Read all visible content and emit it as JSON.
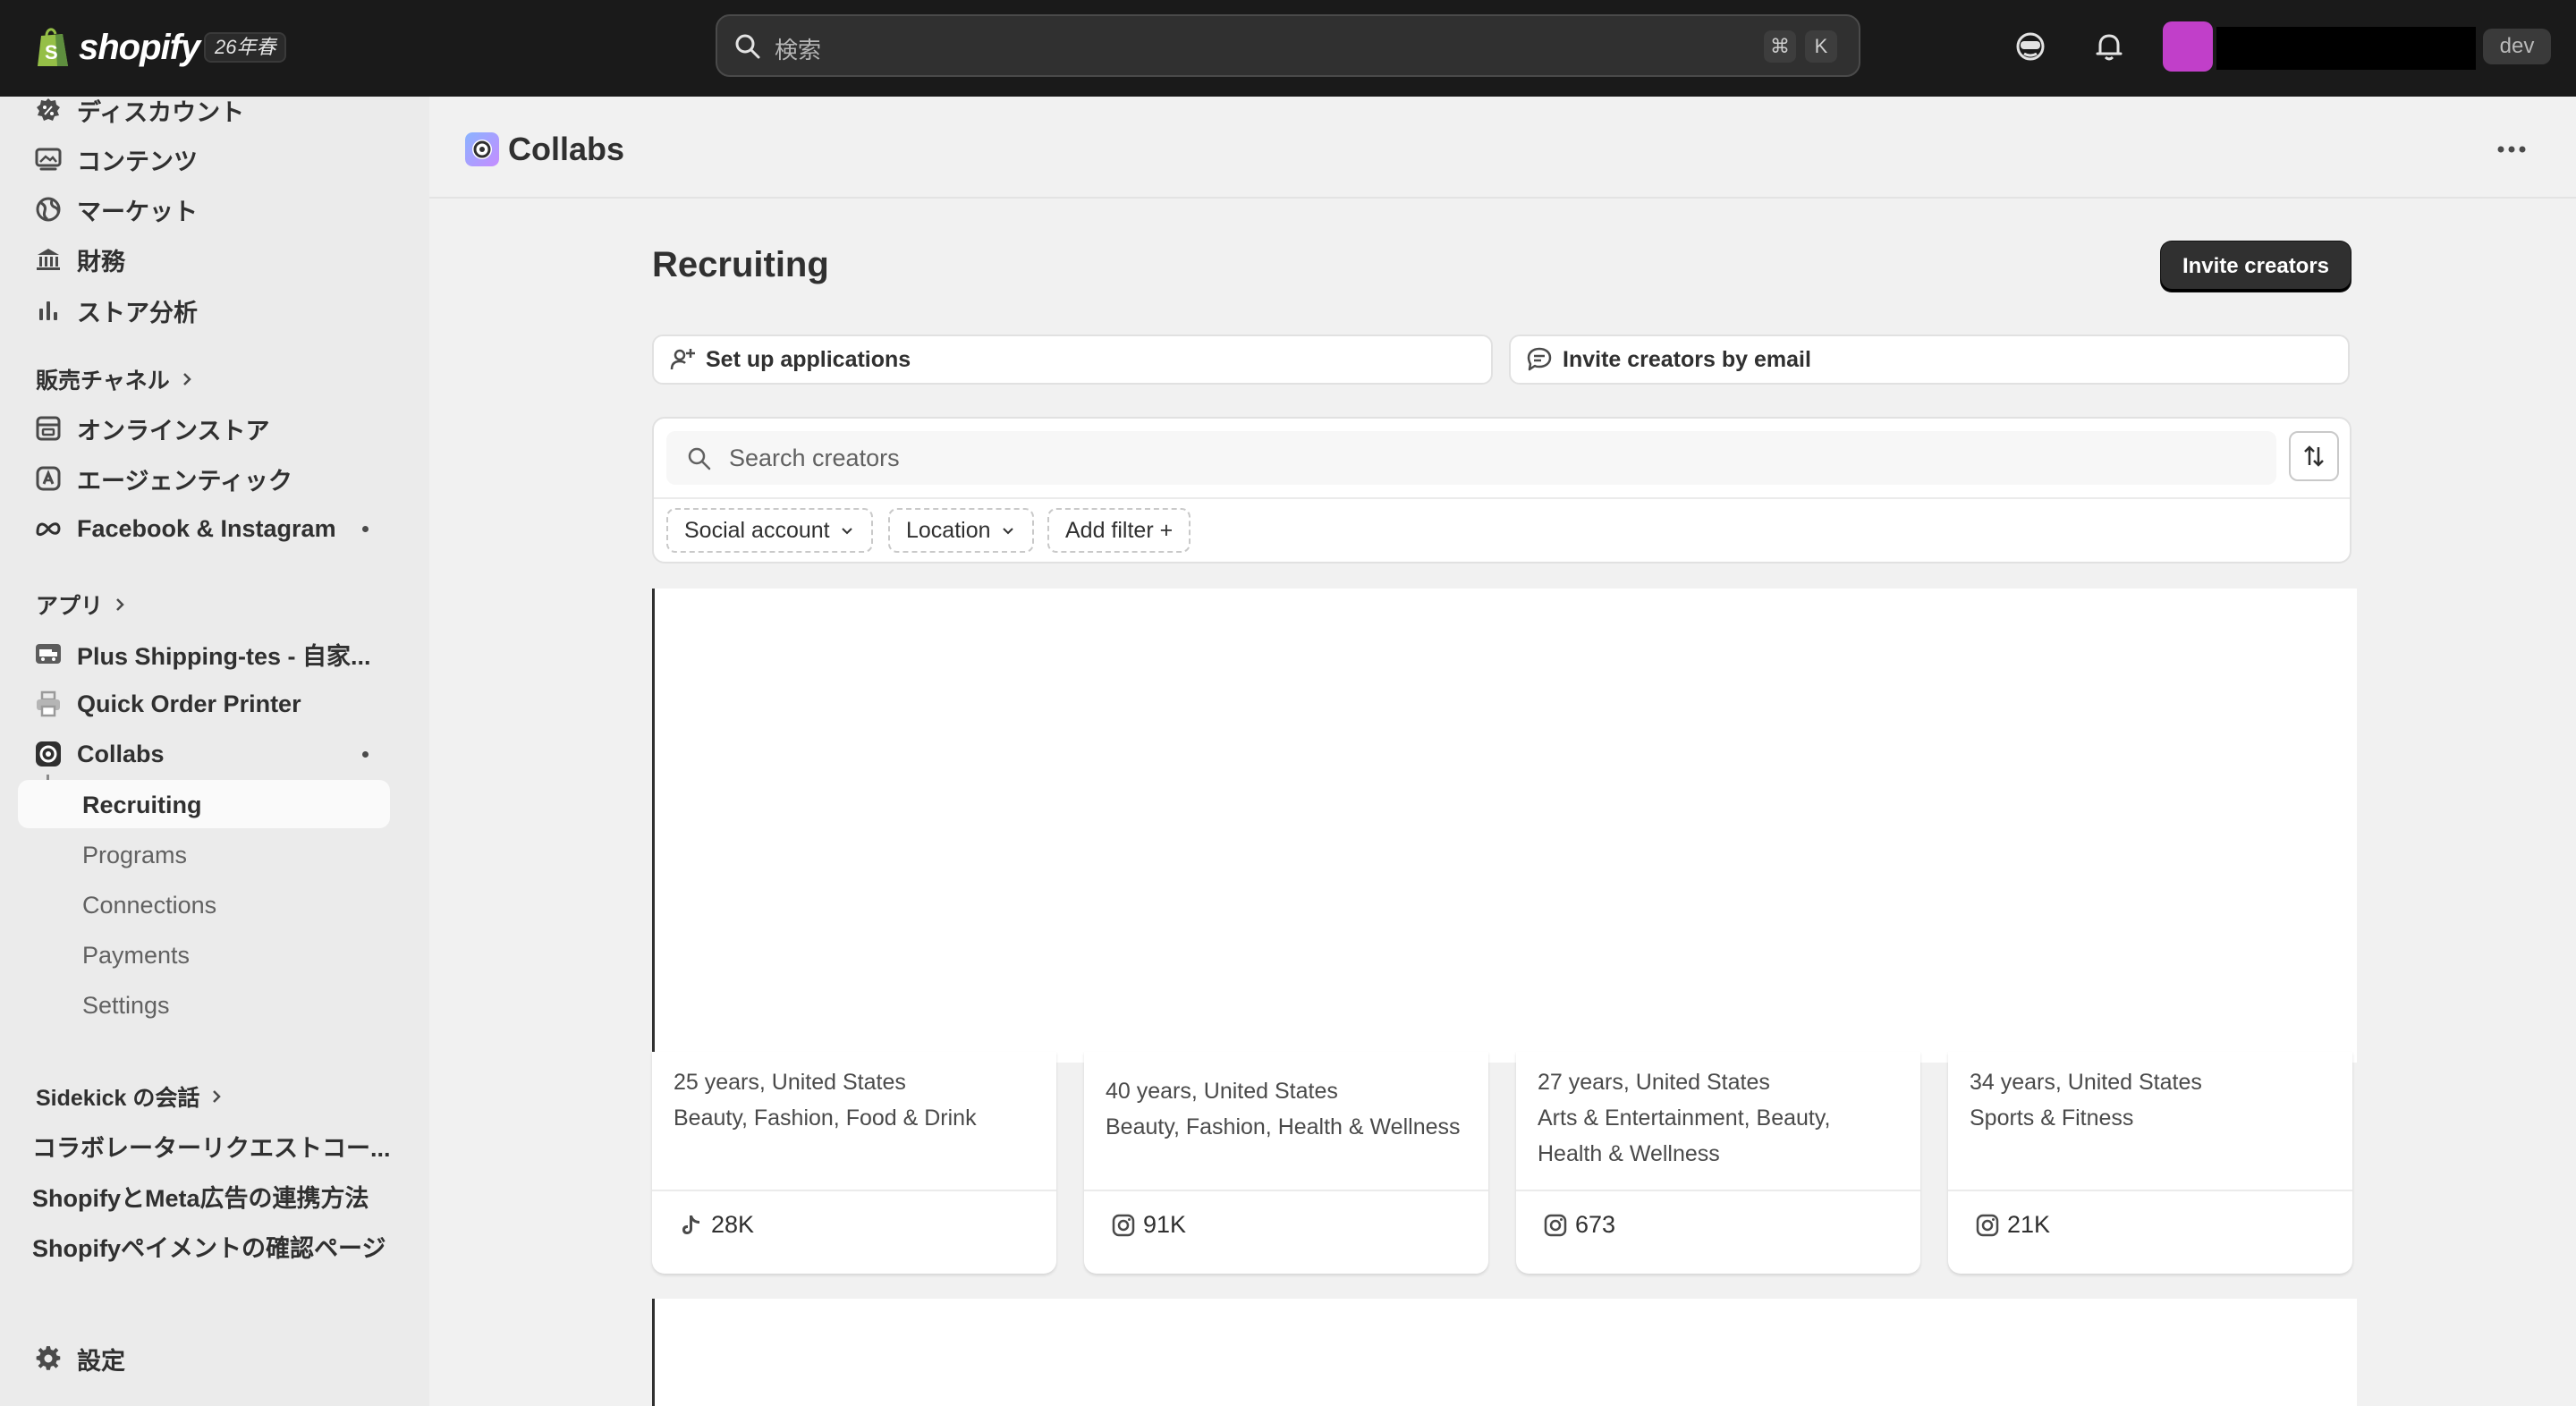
{
  "topbar": {
    "brand": "shopify",
    "season_badge": "26年春",
    "search_placeholder": "検索",
    "shortcut_cmd": "⌘",
    "shortcut_key": "K",
    "store_badge": "dev",
    "store_avatar_color": "#c13fc9"
  },
  "sidebar": {
    "main_items": [
      {
        "label": "ディスカウント",
        "icon": "discount-icon"
      },
      {
        "label": "コンテンツ",
        "icon": "content-icon"
      },
      {
        "label": "マーケット",
        "icon": "globe-icon"
      },
      {
        "label": "財務",
        "icon": "bank-icon"
      },
      {
        "label": "ストア分析",
        "icon": "bar-chart-icon"
      }
    ],
    "sales_channels_heading": "販売チャネル",
    "sales_channels": [
      {
        "label": "オンラインストア",
        "icon": "store-icon"
      },
      {
        "label": "エージェンティック",
        "icon": "agentic-icon"
      },
      {
        "label": "Facebook & Instagram",
        "icon": "meta-icon"
      }
    ],
    "apps_heading": "アプリ",
    "apps": [
      {
        "label": "Plus Shipping-tes - 自家...",
        "icon": "shipping-app-icon"
      },
      {
        "label": "Quick Order Printer",
        "icon": "printer-icon"
      },
      {
        "label": "Collabs",
        "icon": "collabs-icon"
      }
    ],
    "collabs_subitems": [
      "Recruiting",
      "Programs",
      "Connections",
      "Payments",
      "Settings"
    ],
    "active_subitem": "Recruiting",
    "sidekick_heading": "Sidekick の会話",
    "sidekick_items": [
      "コラボレーターリクエストコー...",
      "ShopifyとMeta広告の連携方法",
      "Shopifyペイメントの確認ページ"
    ],
    "settings_label": "設定"
  },
  "main": {
    "app_title": "Collabs",
    "page_title": "Recruiting",
    "invite_button": "Invite creators",
    "actions": {
      "setup_applications": "Set up applications",
      "invite_by_email": "Invite creators by email"
    },
    "search_placeholder": "Search creators",
    "filters": {
      "social_account": "Social account",
      "location": "Location",
      "add_filter": "Add filter +"
    },
    "creators": [
      {
        "line1": "25 years, United States",
        "line2": "Beauty, Fashion, Food & Drink",
        "platform": "tiktok-icon",
        "followers": "28K"
      },
      {
        "line1": "40 years, United States",
        "line2": "Beauty, Fashion, Health & Wellness",
        "platform": "instagram-icon",
        "followers": "91K"
      },
      {
        "line1": "27 years, United States",
        "line2": "Arts & Entertainment, Beauty, Health & Wellness",
        "platform": "instagram-icon",
        "followers": "673"
      },
      {
        "line1": "34 years, United States",
        "line2": "Sports & Fitness",
        "platform": "instagram-icon",
        "followers": "21K"
      }
    ]
  }
}
